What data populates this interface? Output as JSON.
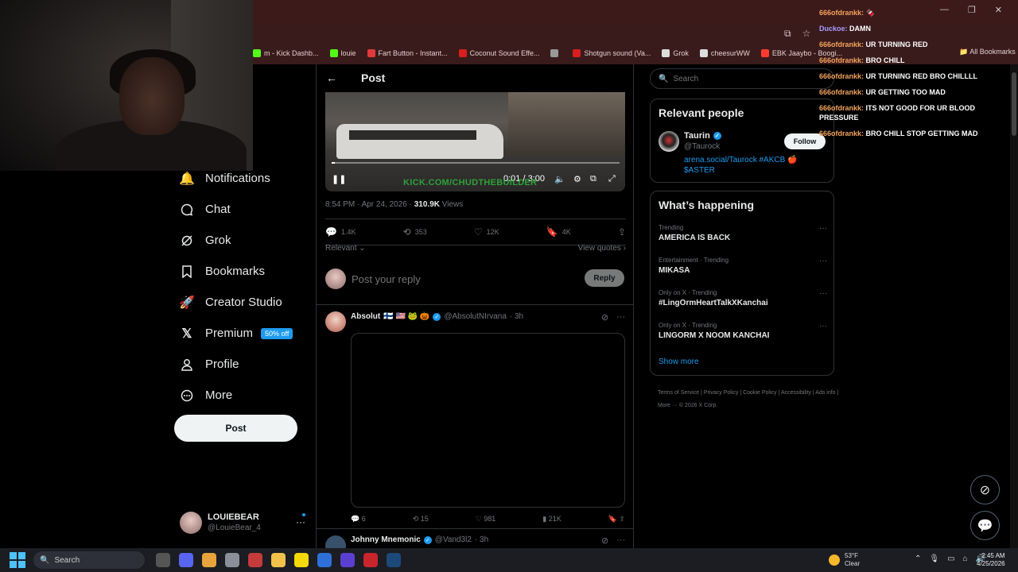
{
  "browser": {
    "bookmarks": [
      {
        "label": "m - Kick Dashb...",
        "icon": "kick-icon",
        "color": "#53fc18"
      },
      {
        "label": "louie",
        "icon": "kick-icon",
        "color": "#53fc18"
      },
      {
        "label": "Fart Button - Instant...",
        "icon": "instant-icon",
        "color": "#e03a3a"
      },
      {
        "label": "Coconut Sound Effe...",
        "icon": "sound-icon",
        "color": "#d81e1e"
      },
      {
        "label": "",
        "icon": "globe-icon",
        "color": "#999999"
      },
      {
        "label": "Shotgun sound (Va...",
        "icon": "sound-icon",
        "color": "#d81e1e"
      },
      {
        "label": "Grok",
        "icon": "grok-icon",
        "color": "#dddddd"
      },
      {
        "label": "cheesurWW",
        "icon": "globe-icon",
        "color": "#dddddd"
      },
      {
        "label": "EBK Jaaybo - Boogi...",
        "icon": "video-icon",
        "color": "#ff3b30"
      }
    ],
    "all_bookmarks": "All Bookmarks"
  },
  "nav": {
    "items": [
      {
        "label": "Notifications",
        "icon": "bell-icon"
      },
      {
        "label": "Chat",
        "icon": "chat-icon"
      },
      {
        "label": "Grok",
        "icon": "grok-icon"
      },
      {
        "label": "Bookmarks",
        "icon": "bookmark-icon"
      },
      {
        "label": "Creator Studio",
        "icon": "rocket-icon"
      },
      {
        "label": "Premium",
        "icon": "x-icon",
        "badge": "50% off"
      },
      {
        "label": "Profile",
        "icon": "person-icon"
      },
      {
        "label": "More",
        "icon": "more-circle-icon"
      }
    ],
    "post_button": "Post",
    "account": {
      "name": "LOUIEBEAR",
      "handle": "@LouieBear_4"
    }
  },
  "post": {
    "header_title": "Post",
    "video": {
      "time": "0:01 / 3:00",
      "watermark": "KICK.COM/CHUDTHEBUILDER",
      "progress": 0.01
    },
    "timestamp": "8:54 PM · Apr 24, 2026 · ",
    "views_count": "310.9K",
    "views_label": " Views",
    "stats": {
      "replies": "1.4K",
      "reposts": "353",
      "likes": "12K",
      "bookmarks": "4K"
    },
    "sort_label": "Relevant",
    "view_quotes": "View quotes",
    "reply_placeholder": "Post your reply",
    "reply_button": "Reply"
  },
  "reply": {
    "name": "Absolut",
    "emojis": "🇫🇮 🇺🇸 🐸 🎃",
    "handle": "@AbsolutNIrvana",
    "time": "· 3h",
    "stats": {
      "replies": "6",
      "reposts": "15",
      "likes": "981",
      "views": "21K"
    }
  },
  "next_reply": {
    "name": "Johnny Mnemonic",
    "handle": "@Vand3l2",
    "time": "· 3h"
  },
  "right": {
    "search_placeholder": "Search",
    "relevant_title": "Relevant people",
    "person": {
      "name": "Taurin",
      "handle": "@Taurock",
      "bio": "arena.social/Taurock #AKCB 🍎 $ASTER",
      "follow": "Follow"
    },
    "happening_title": "What’s happening",
    "trends": [
      {
        "category": "Trending",
        "name": "AMERICA IS BACK"
      },
      {
        "category": "Entertainment · Trending",
        "name": "MIKASA"
      },
      {
        "category": "Only on X · Trending",
        "name": "#LingOrmHeartTalkXKanchai"
      },
      {
        "category": "Only on X · Trending",
        "name": "LINGORM X NOOM KANCHAI"
      }
    ],
    "show_more": "Show more",
    "footer": "Terms of Service | Privacy Policy | Cookie Policy | Accessibility | Ads info | More ··· © 2026 X Corp."
  },
  "chat": [
    {
      "user": "666ofdrankk:",
      "text": "🍫",
      "color": "#f4a35c"
    },
    {
      "user": "Duckoe:",
      "text": "DAMN",
      "color": "#a99bff"
    },
    {
      "user": "666ofdrankk:",
      "text": "UR TURNING RED",
      "color": "#f4a35c"
    },
    {
      "user": "666ofdrankk:",
      "text": "BRO CHILL",
      "color": "#f4a35c"
    },
    {
      "user": "666ofdrankk:",
      "text": "UR TURNING RED BRO CHILLLL",
      "color": "#f4a35c"
    },
    {
      "user": "666ofdrankk:",
      "text": "UR GETTING TOO MAD",
      "color": "#f4a35c"
    },
    {
      "user": "666ofdrankk:",
      "text": "ITS NOT GOOD FOR UR BLOOD PRESSURE",
      "color": "#f4a35c"
    },
    {
      "user": "666ofdrankk:",
      "text": "BRO CHILL STOP GETTING MAD",
      "color": "#f4a35c"
    }
  ],
  "taskbar": {
    "search": "Search",
    "weather_temp": "53°F",
    "weather_desc": "Clear",
    "time": "2:45 AM",
    "date": "4/25/2026"
  }
}
